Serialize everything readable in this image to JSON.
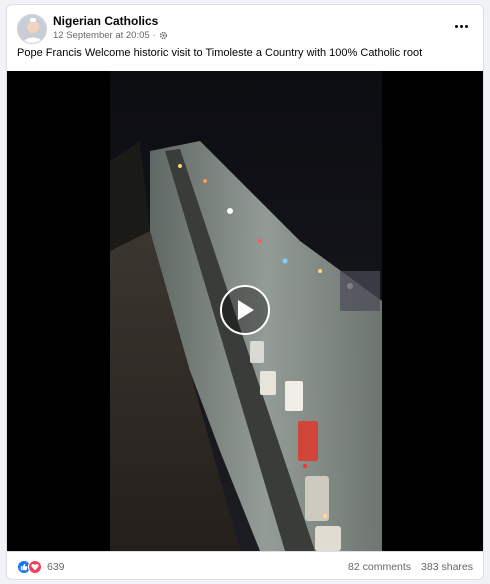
{
  "post": {
    "author": "Nigerian Catholics",
    "timestamp": "12 September at 20:05",
    "audience_icon": "gear-icon",
    "caption": "Pope Francis Welcome historic visit to Timoleste a Country with 100% Catholic root"
  },
  "video": {
    "play_icon": "play-icon"
  },
  "footer": {
    "reaction_icons": [
      "like-icon",
      "love-icon"
    ],
    "reaction_count": "639",
    "comments": "82 comments",
    "shares": "383 shares"
  },
  "colors": {
    "accent": "#1877f2",
    "love": "#f33e58",
    "secondary_text": "#65676b"
  }
}
